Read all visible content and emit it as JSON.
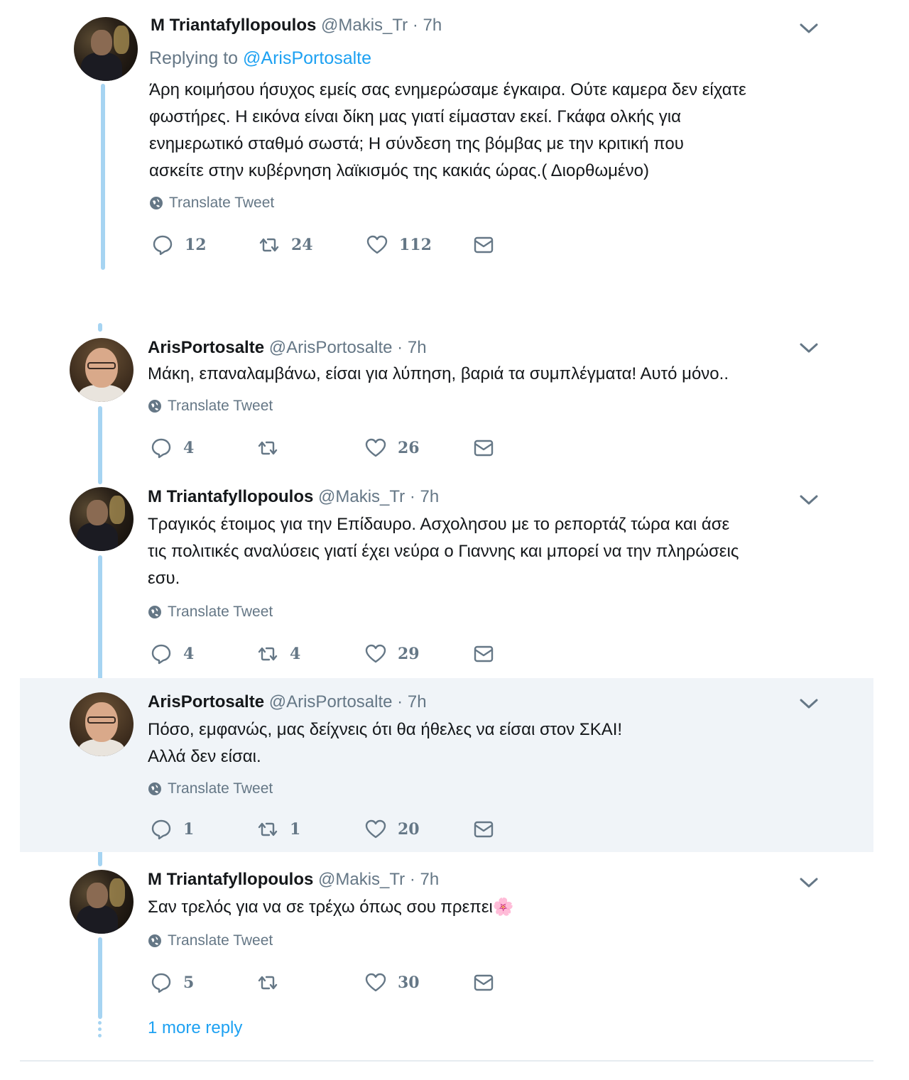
{
  "tweets": [
    {
      "name": "M Triantafyllopoulos",
      "handle": "@Makis_Tr",
      "separator": "·",
      "time": "7h",
      "replying_label": "Replying to",
      "replying_to": "@ArisPortosalte",
      "lines": [
        "Άρη κοιμήσου ήσυχος εμείς σας ενημερώσαμε έγκαιρα. Ούτε καμερα δεν είχατε",
        "φωστήρες. Η εικόνα είναι δίκη μας γιατί είμασταν εκεί. Γκάφα ολκής για",
        "ενημερωτικό σταθμό σωστά; Η σύνδεση της βόμβας με την κριτική που",
        "ασκείτε στην κυβέρνηση λαϊκισμός της κακιάς ώρας.( Διορθωμένο)"
      ],
      "translate": "Translate Tweet",
      "replies": "12",
      "retweets": "24",
      "likes": "112"
    },
    {
      "name": "ArisPortosalte",
      "handle": "@ArisPortosalte",
      "separator": "·",
      "time": "7h",
      "lines": [
        "Μάκη, επαναλαμβάνω, είσαι για λύπηση, βαριά τα συμπλέγματα! Αυτό μόνο.."
      ],
      "translate": "Translate Tweet",
      "replies": "4",
      "retweets": "",
      "likes": "26"
    },
    {
      "name": "M Triantafyllopoulos",
      "handle": "@Makis_Tr",
      "separator": "·",
      "time": "7h",
      "lines": [
        "Τραγικός έτοιμος για την Επίδαυρο. Ασχολησου με το ρεπορτάζ τώρα και άσε",
        "τις πολιτικές αναλύσεις γιατί έχει νεύρα ο Γιαννης και μπορεί να την πληρώσεις",
        "εσυ."
      ],
      "translate": "Translate Tweet",
      "replies": "4",
      "retweets": "4",
      "likes": "29"
    },
    {
      "name": "ArisPortosalte",
      "handle": "@ArisPortosalte",
      "separator": "·",
      "time": "7h",
      "lines": [
        "Πόσο, εμφανώς, μας δείχνεις ότι θα ήθελες να είσαι στον ΣΚΑΙ!",
        "Αλλά δεν είσαι."
      ],
      "translate": "Translate Tweet",
      "replies": "1",
      "retweets": "1",
      "likes": "20"
    },
    {
      "name": "M Triantafyllopoulos",
      "handle": "@Makis_Tr",
      "separator": "·",
      "time": "7h",
      "lines": [
        "Σαν τρελός για να σε τρέχω όπως σου πρεπει"
      ],
      "emoji": "🌸",
      "translate": "Translate Tweet",
      "replies": "5",
      "retweets": "",
      "likes": "30"
    }
  ],
  "more_replies": "1 more reply",
  "colors": {
    "accent": "#1da1f2",
    "thread_line": "#a6d4f2",
    "muted": "#657786",
    "highlight_bg": "#f0f4f8"
  },
  "icons": [
    "reply-icon",
    "retweet-icon",
    "like-icon",
    "dm-icon",
    "globe-icon",
    "chevron-down-icon",
    "flower-icon"
  ]
}
